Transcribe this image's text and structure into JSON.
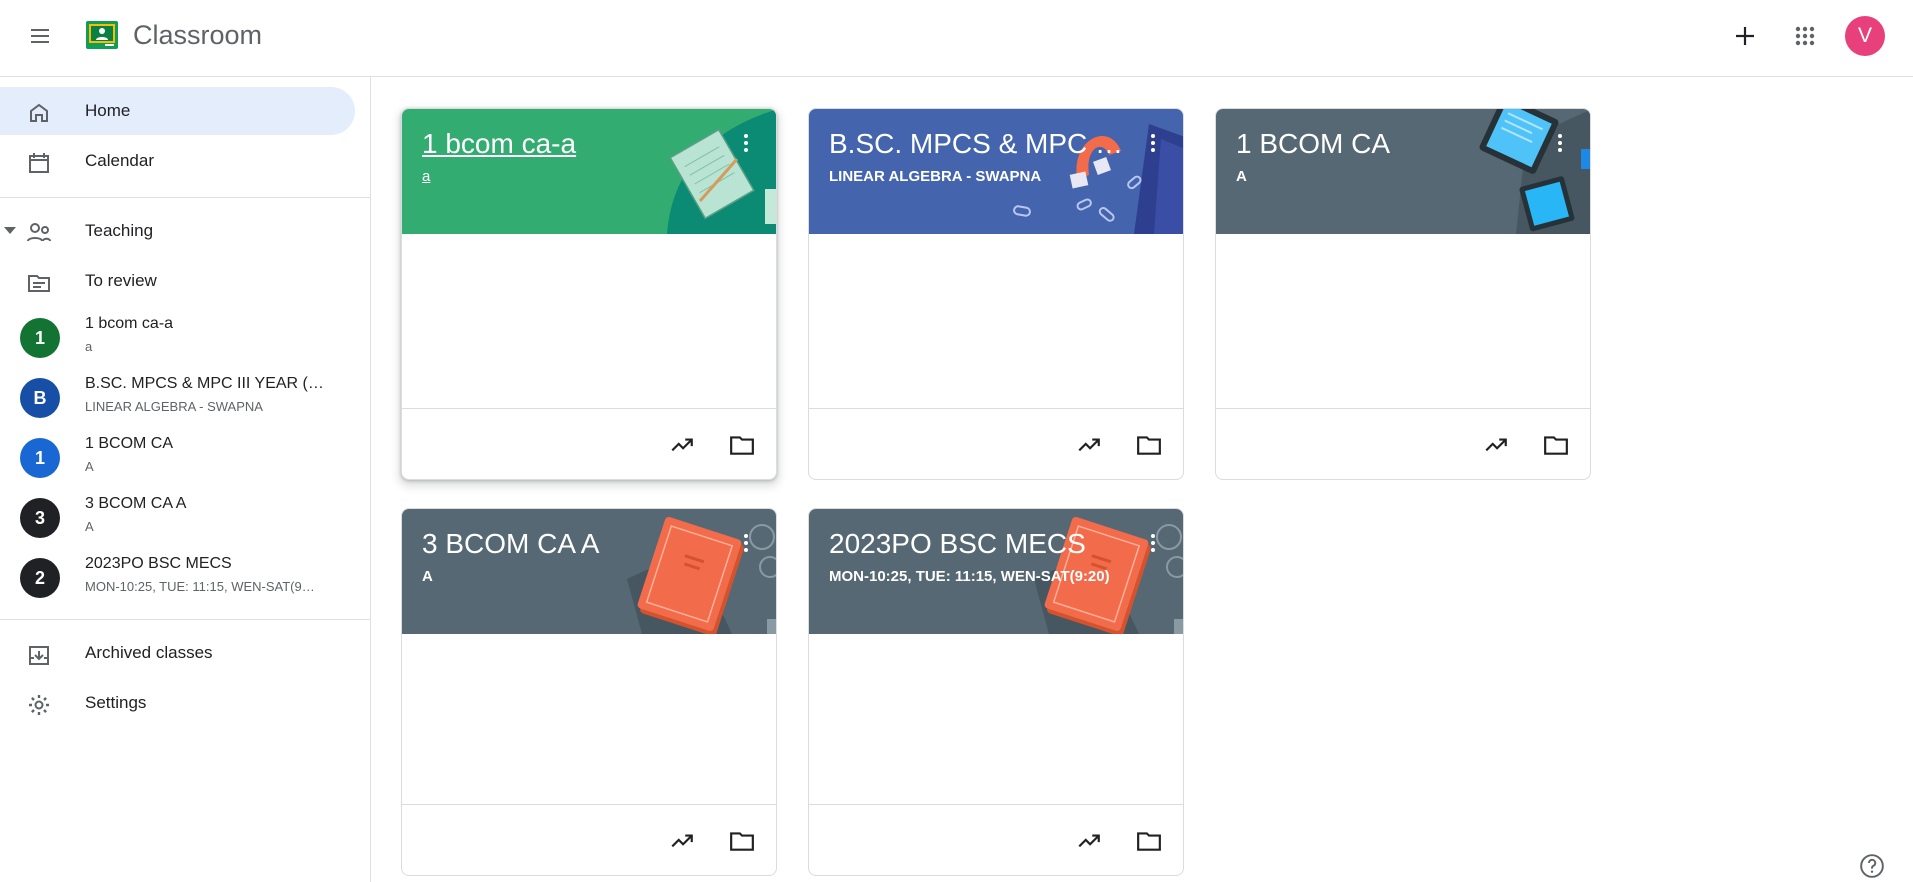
{
  "app": {
    "title": "Classroom",
    "avatar_letter": "V"
  },
  "header": {
    "menu_icon": "hamburger-icon",
    "add_icon": "plus-icon",
    "apps_icon": "apps-grid-icon"
  },
  "sidebar": {
    "home": "Home",
    "calendar": "Calendar",
    "teaching": "Teaching",
    "to_review": "To review",
    "classes": [
      {
        "letter": "1",
        "name": "1 bcom ca-a",
        "sub": "a",
        "color": "#137333"
      },
      {
        "letter": "B",
        "name": "B.SC. MPCS & MPC III YEAR (…",
        "sub": "LINEAR ALGEBRA - SWAPNA",
        "color": "#174ea6"
      },
      {
        "letter": "1",
        "name": "1 BCOM CA",
        "sub": "A",
        "color": "#1967d2"
      },
      {
        "letter": "3",
        "name": "3 BCOM CA A",
        "sub": "A",
        "color": "#202124"
      },
      {
        "letter": "2",
        "name": "2023PO BSC MECS",
        "sub": "MON-10:25, TUE: 11:15, WEN-SAT(9…",
        "color": "#202124"
      }
    ],
    "archived": "Archived classes",
    "settings": "Settings"
  },
  "cards": [
    {
      "title": "1 bcom ca-a",
      "sub": "a",
      "color": "#33ac71",
      "theme": "notebook"
    },
    {
      "title": "B.SC. MPCS & MPC III…",
      "sub": "LINEAR ALGEBRA - SWAPNA",
      "color": "#4464ad",
      "theme": "magnet"
    },
    {
      "title": "1 BCOM CA",
      "sub": "A",
      "color": "#566873",
      "theme": "devices"
    },
    {
      "title": "3 BCOM CA A",
      "sub": "A",
      "color": "#566873",
      "theme": "book"
    },
    {
      "title": "2023PO BSC MECS",
      "sub": "MON-10:25, TUE: 11:15, WEN-SAT(9:20)",
      "color": "#566873",
      "theme": "book"
    }
  ]
}
